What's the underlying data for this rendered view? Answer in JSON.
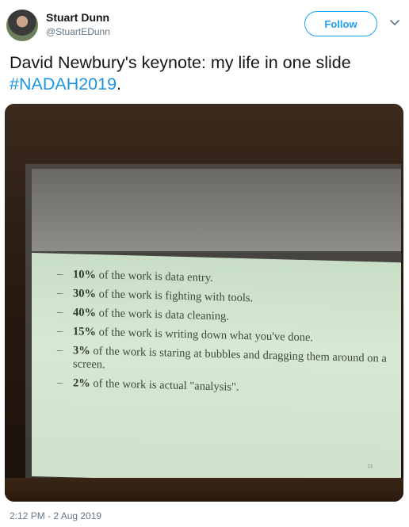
{
  "tweet": {
    "author_name": "Stuart Dunn",
    "author_handle": "@StuartEDunn",
    "follow_label": "Follow",
    "text_main": "David Newbury's keynote: my life in one slide ",
    "hashtag": "#NADAH2019",
    "text_end": ".",
    "timestamp": "2:12 PM - 2 Aug 2019"
  },
  "slide": {
    "items": [
      {
        "bold": "10%",
        "rest": " of the work is data entry."
      },
      {
        "bold": "30%",
        "rest": " of the work is fighting with tools."
      },
      {
        "bold": "40%",
        "rest": " of the work is data cleaning."
      },
      {
        "bold": "15%",
        "rest": " of the work is writing down what you've done."
      },
      {
        "bold": "3%",
        "rest": " of the work is staring at bubbles and dragging them around on a screen."
      },
      {
        "bold": "2%",
        "rest": " of the work is actual \"analysis\"."
      }
    ],
    "page_number": "13"
  },
  "icons": {
    "menu": "chevron-down-icon"
  },
  "colors": {
    "accent": "#1da1f2",
    "hashtag": "#1b95e0",
    "muted": "#657786"
  }
}
